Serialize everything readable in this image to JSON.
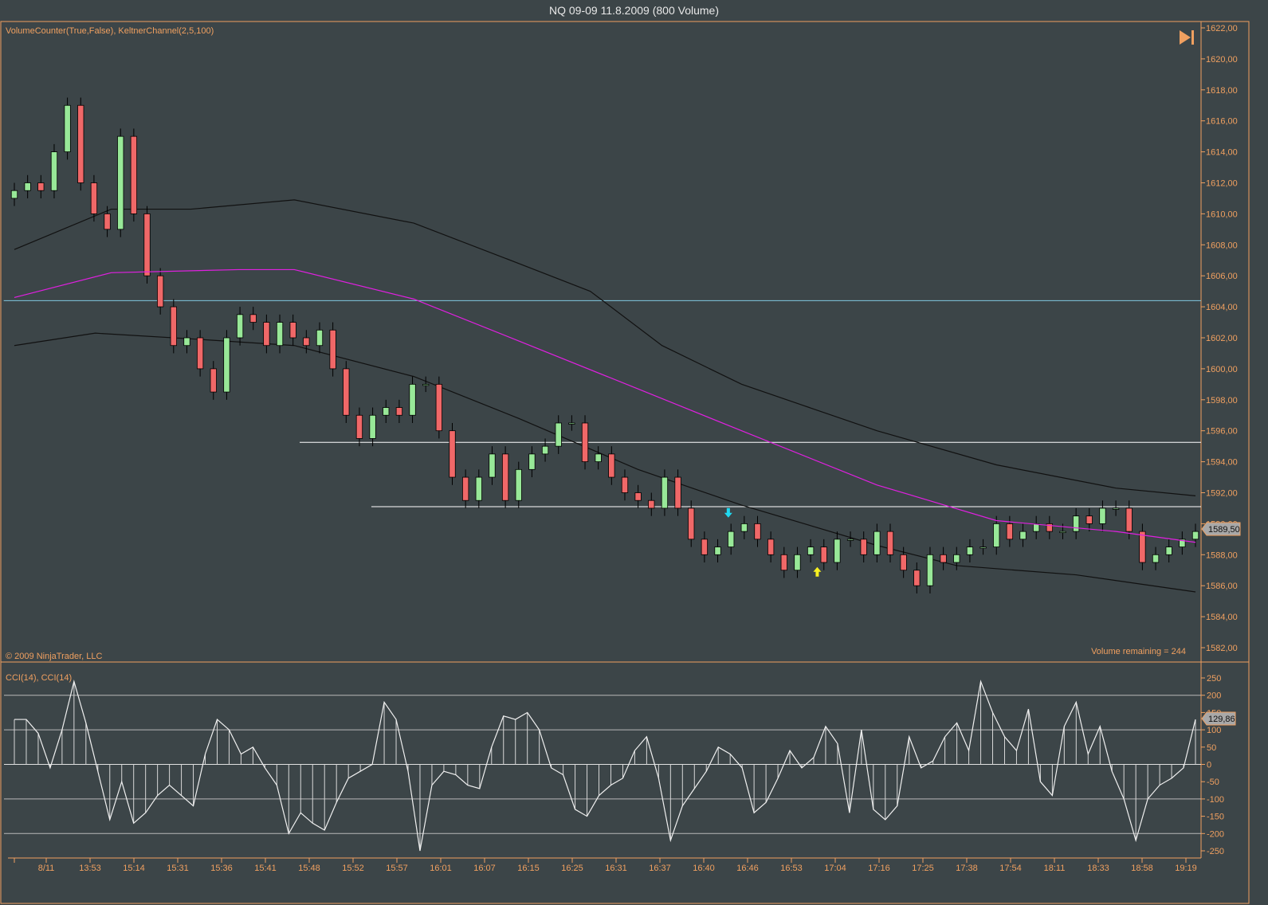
{
  "window": {
    "title": "NQ 09-09  11.8.2009 (800 Volume)"
  },
  "price_panel": {
    "indicator_label": "VolumeCounter(True,False), KeltnerChannel(2,5,100)",
    "copyright": "© 2009 NinjaTrader, LLC",
    "volume_remaining": "Volume remaining = 244",
    "current_price_tag": "1589,50",
    "play_button_icon": "skip-to-end-icon"
  },
  "cci_panel": {
    "label": "CCI(14), CCI(14)",
    "current_value_tag": "129,86"
  },
  "colors": {
    "background": "#3c4548",
    "accent": "#f0a060",
    "up": "#98e898",
    "down": "#f06868",
    "mid": "#e020e0",
    "band": "#111111",
    "hline_cyan": "#80c8e0",
    "hline_white": "#ffffff"
  },
  "chart_data": [
    {
      "type": "candlestick",
      "title": "NQ 09-09  11.8.2009 (800 Volume)",
      "y_range": [
        1581,
        1622.5
      ],
      "y_ticks": [
        "1622,00",
        "1620,00",
        "1618,00",
        "1616,00",
        "1614,00",
        "1612,00",
        "1610,00",
        "1608,00",
        "1606,00",
        "1604,00",
        "1602,00",
        "1600,00",
        "1598,00",
        "1596,00",
        "1594,00",
        "1592,00",
        "1590,00",
        "1588,00",
        "1586,00",
        "1584,00",
        "1582,00"
      ],
      "x_ticks": [
        "8/11",
        "13:53",
        "15:14",
        "15:31",
        "15:36",
        "15:41",
        "15:48",
        "15:52",
        "15:57",
        "16:01",
        "16:07",
        "16:15",
        "16:25",
        "16:31",
        "16:37",
        "16:40",
        "16:46",
        "16:53",
        "17:04",
        "17:16",
        "17:25",
        "17:38",
        "17:54",
        "18:11",
        "18:33",
        "18:58",
        "19:19"
      ],
      "close": [
        1611.5,
        1612,
        1611.5,
        1614,
        1617,
        1612,
        1610,
        1609,
        1615,
        1610,
        1606,
        1604,
        1601.5,
        1602,
        1600,
        1598.5,
        1602,
        1603.5,
        1603,
        1601.5,
        1603,
        1602,
        1601.5,
        1602.5,
        1600,
        1597,
        1595.5,
        1597,
        1597.5,
        1597,
        1599,
        1599,
        1596,
        1593,
        1591.5,
        1593,
        1594.5,
        1591.5,
        1593.5,
        1594.5,
        1595,
        1596.5,
        1596.5,
        1594,
        1594.5,
        1593,
        1592,
        1591.5,
        1591,
        1593,
        1591,
        1589,
        1588,
        1588.5,
        1589.5,
        1590,
        1589,
        1588,
        1587,
        1588,
        1588.5,
        1587.5,
        1589,
        1589,
        1588,
        1589.5,
        1588,
        1587,
        1586,
        1588,
        1587.5,
        1588,
        1588.5,
        1588.5,
        1590,
        1589,
        1589.5,
        1590,
        1589.5,
        1589.5,
        1590.5,
        1590,
        1591,
        1591,
        1589.5,
        1587.5,
        1588,
        1588.5,
        1589,
        1589.5
      ],
      "first_open": 1611,
      "keltner_mid": [
        [
          0,
          1604.6
        ],
        [
          7.3,
          1606.2
        ],
        [
          16.9,
          1606.4
        ],
        [
          21.1,
          1606.4
        ],
        [
          30.1,
          1604.5
        ],
        [
          38,
          1601.8
        ],
        [
          47,
          1598.7
        ],
        [
          54.8,
          1596
        ],
        [
          65,
          1592.5
        ],
        [
          74,
          1590.2
        ],
        [
          83,
          1589.5
        ],
        [
          89,
          1588.8
        ]
      ],
      "keltner_upper": [
        [
          0,
          1607.7
        ],
        [
          7.3,
          1610.3
        ],
        [
          13.3,
          1610.3
        ],
        [
          21.1,
          1610.9
        ],
        [
          30.1,
          1609.4
        ],
        [
          38,
          1606.8
        ],
        [
          43.4,
          1605
        ],
        [
          48.8,
          1601.5
        ],
        [
          54.8,
          1599
        ],
        [
          65,
          1596
        ],
        [
          74,
          1593.8
        ],
        [
          83,
          1592.3
        ],
        [
          89,
          1591.8
        ]
      ],
      "keltner_lower": [
        [
          0,
          1601.5
        ],
        [
          6.1,
          1602.3
        ],
        [
          13.9,
          1601.9
        ],
        [
          21.1,
          1601.5
        ],
        [
          30.1,
          1599.5
        ],
        [
          38,
          1596.8
        ],
        [
          47,
          1593.5
        ],
        [
          54.8,
          1591.2
        ],
        [
          65,
          1588.6
        ],
        [
          71,
          1587.3
        ],
        [
          80,
          1586.7
        ],
        [
          89,
          1585.6
        ]
      ],
      "horizontal_lines": [
        {
          "price": 1604.4,
          "from": -0.8,
          "color": "cyan"
        },
        {
          "price": 1595.25,
          "from": 21.5,
          "color": "white"
        },
        {
          "price": 1591.1,
          "from": 26.9,
          "color": "white"
        }
      ],
      "markers": [
        {
          "type": "down-arrow",
          "bar": 53.8,
          "price": 1590.6,
          "color": "#20d8f0"
        },
        {
          "type": "up-arrow",
          "bar": 60.5,
          "price": 1587,
          "color": "#f8f020"
        }
      ]
    },
    {
      "type": "line",
      "title": "CCI(14), CCI(14)",
      "y_range": [
        -270,
        270
      ],
      "y_ticks": [
        "250",
        "200",
        "150",
        "100",
        "50",
        "0",
        "-50",
        "-100",
        "-150",
        "-200",
        "-250"
      ],
      "grid_levels": [
        200,
        100,
        0,
        -100,
        -200
      ],
      "values": [
        130,
        130,
        90,
        -10,
        100,
        240,
        120,
        -20,
        -160,
        -50,
        -170,
        -140,
        -90,
        -60,
        -90,
        -120,
        30,
        130,
        100,
        30,
        50,
        -10,
        -60,
        -200,
        -140,
        -170,
        -190,
        -110,
        -40,
        -20,
        0,
        180,
        130,
        -20,
        -250,
        -60,
        -20,
        -30,
        -60,
        -70,
        50,
        140,
        130,
        150,
        100,
        -10,
        -30,
        -130,
        -150,
        -90,
        -60,
        -40,
        40,
        80,
        -40,
        -220,
        -120,
        -70,
        -20,
        50,
        30,
        -10,
        -140,
        -110,
        -40,
        40,
        -10,
        20,
        110,
        60,
        -140,
        100,
        -130,
        -160,
        -120,
        80,
        -10,
        10,
        80,
        120,
        40,
        240,
        150,
        80,
        40,
        160,
        -50,
        -90,
        110,
        180,
        30,
        110,
        -20,
        -100,
        -220,
        -100,
        -60,
        -40,
        -10,
        130
      ]
    }
  ]
}
